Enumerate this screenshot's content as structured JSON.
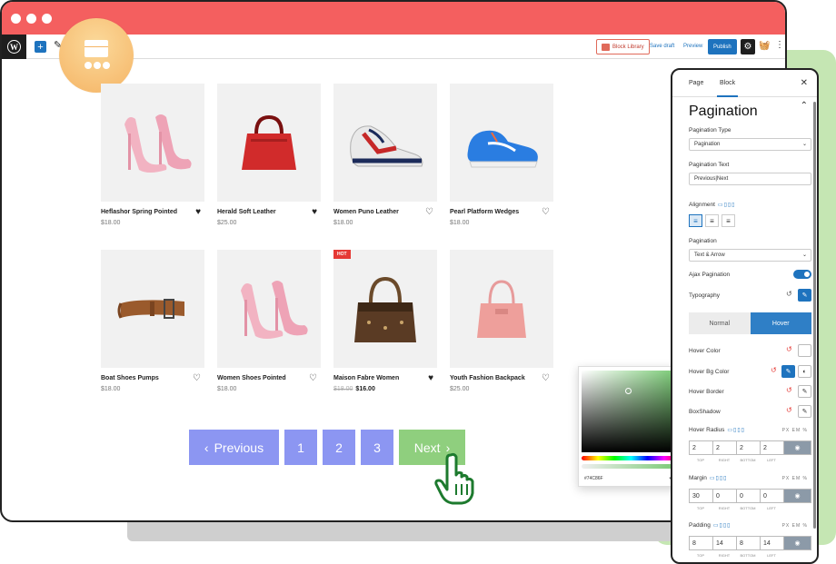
{
  "toolbar": {
    "block_library": "Block Library",
    "save_draft": "Save draft",
    "preview": "Preview",
    "publish": "Publish"
  },
  "products": [
    {
      "name": "Heflashor Spring Pointed",
      "price": "$18.00",
      "liked": true,
      "image": "pink-heels"
    },
    {
      "name": "Herald Soft Leather",
      "price": "$25.00",
      "liked": true,
      "image": "red-handbag"
    },
    {
      "name": "Women Puno Leather",
      "price": "$18.00",
      "liked": false,
      "image": "sneaker"
    },
    {
      "name": "Pearl Platform Wedges",
      "price": "$18.00",
      "liked": false,
      "image": "blue-sneaker"
    },
    {
      "name": "Boat Shoes Pumps",
      "price": "$18.00",
      "liked": false,
      "image": "belt"
    },
    {
      "name": "Women Shoes Pointed",
      "price": "$18.00",
      "liked": false,
      "image": "pink-heels"
    },
    {
      "name": "Maison Fabre Women",
      "old_price": "$18.00",
      "price": "$16.00",
      "liked": true,
      "badge": "HOT",
      "image": "brown-bag"
    },
    {
      "name": "Youth Fashion Backpack",
      "price": "$25.00",
      "liked": false,
      "image": "pink-bag"
    }
  ],
  "pagination": {
    "previous": "Previous",
    "pages": [
      "1",
      "2",
      "3"
    ],
    "next": "Next"
  },
  "panel": {
    "tab_page": "Page",
    "tab_block": "Block",
    "title": "Pagination",
    "pagination_type_label": "Pagination Type",
    "pagination_type_value": "Pagination",
    "pagination_text_label": "Pagination Text",
    "pagination_text_value": "Previous|Next",
    "alignment_label": "Alignment",
    "pagination_label": "Pagination",
    "pagination_value": "Text & Arrow",
    "ajax_label": "Ajax Pagination",
    "ajax_on": true,
    "typography_label": "Typography",
    "normal_tab": "Normal",
    "hover_tab": "Hover",
    "hover_color_label": "Hover Color",
    "hover_bg_label": "Hover Bg Color",
    "hover_border_label": "Hover Border",
    "boxshadow_label": "BoxShadow",
    "hover_radius_label": "Hover Radius",
    "units": "PX  EM  %",
    "radius": [
      "2",
      "2",
      "2",
      "2"
    ],
    "margin_label": "Margin",
    "margin": [
      "30",
      "0",
      "0",
      "0"
    ],
    "padding_label": "Padding",
    "padding": [
      "8",
      "14",
      "8",
      "14"
    ],
    "side_labels": [
      "TOP",
      "RIGHT",
      "BOTTOM",
      "LEFT"
    ]
  },
  "picker": {
    "hex": "#74C86F",
    "color": "#74c86f"
  },
  "colors": {
    "titlebar": "#f45f5f",
    "pagination": "#8c96f2",
    "next": "#8fcf7e",
    "accent": "#1e73be"
  }
}
